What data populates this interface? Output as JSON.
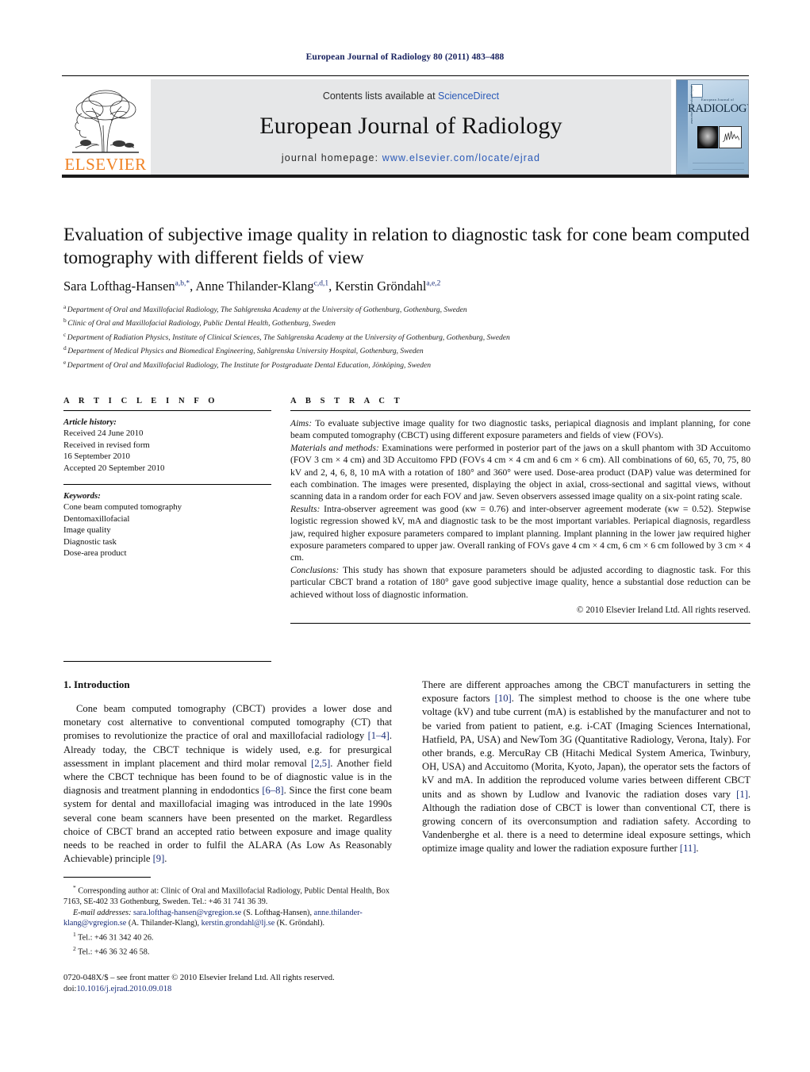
{
  "running_head": "European Journal of Radiology 80 (2011) 483–488",
  "masthead": {
    "contents_prefix": "Contents lists available at ",
    "sciencedirect": "ScienceDirect",
    "journal_name": "European Journal of Radiology",
    "homepage_prefix": "journal homepage: ",
    "homepage_url": "www.elsevier.com/locate/ejrad",
    "publisher": "ELSEVIER",
    "accent_orange": "#f08122",
    "link_blue": "#2b5ab8",
    "band_grey": "#e6e7e8"
  },
  "cover": {
    "small_title": "European Journal of",
    "big_title": "RADIOLOGY",
    "spine_text": "www.elsevier.com/locate/ejrad"
  },
  "article": {
    "title": "Evaluation of subjective image quality in relation to diagnostic task for cone beam computed tomography with different fields of view",
    "authors": [
      {
        "name": "Sara Lofthag-Hansen",
        "sup": "a,b,*"
      },
      {
        "name": "Anne Thilander-Klang",
        "sup": "c,d,1"
      },
      {
        "name": "Kerstin Gröndahl",
        "sup": "a,e,2"
      }
    ],
    "affiliations": [
      {
        "mark": "a",
        "text": "Department of Oral and Maxillofacial Radiology, The Sahlgrenska Academy at the University of Gothenburg, Gothenburg, Sweden"
      },
      {
        "mark": "b",
        "text": "Clinic of Oral and Maxillofacial Radiology, Public Dental Health, Gothenburg, Sweden"
      },
      {
        "mark": "c",
        "text": "Department of Radiation Physics, Institute of Clinical Sciences, The Sahlgrenska Academy at the University of Gothenburg, Gothenburg, Sweden"
      },
      {
        "mark": "d",
        "text": "Department of Medical Physics and Biomedical Engineering, Sahlgrenska University Hospital, Gothenburg, Sweden"
      },
      {
        "mark": "e",
        "text": "Department of Oral and Maxillofacial Radiology, The Institute for Postgraduate Dental Education, Jönköping, Sweden"
      }
    ]
  },
  "article_info": {
    "label": "A R T I C L E    I N F O",
    "history_head": "Article history:",
    "history": [
      "Received 24 June 2010",
      "Received in revised form",
      "16 September 2010",
      "Accepted 20 September 2010"
    ],
    "keywords_head": "Keywords:",
    "keywords": [
      "Cone beam computed tomography",
      "Dentomaxillofacial",
      "Image quality",
      "Diagnostic task",
      "Dose-area product"
    ]
  },
  "abstract": {
    "label": "A B S T R A C T",
    "aims_head": "Aims:",
    "aims_text": " To evaluate subjective image quality for two diagnostic tasks, periapical diagnosis and implant planning, for cone beam computed tomography (CBCT) using different exposure parameters and fields of view (FOVs).",
    "methods_head": "Materials and methods:",
    "methods_text": " Examinations were performed in posterior part of the jaws on a skull phantom with 3D Accuitomo (FOV 3 cm × 4 cm) and 3D Accuitomo FPD (FOVs 4 cm × 4 cm and 6 cm × 6 cm). All combinations of 60, 65, 70, 75, 80 kV and 2, 4, 6, 8, 10 mA with a rotation of 180° and 360° were used. Dose-area product (DAP) value was determined for each combination. The images were presented, displaying the object in axial, cross-sectional and sagittal views, without scanning data in a random order for each FOV and jaw. Seven observers assessed image quality on a six-point rating scale.",
    "results_head": "Results:",
    "results_text": " Intra-observer agreement was good (κw = 0.76) and inter-observer agreement moderate (κw = 0.52). Stepwise logistic regression showed kV, mA and diagnostic task to be the most important variables. Periapical diagnosis, regardless jaw, required higher exposure parameters compared to implant planning. Implant planning in the lower jaw required higher exposure parameters compared to upper jaw. Overall ranking of FOVs gave 4 cm × 4 cm, 6 cm × 6 cm followed by 3 cm × 4 cm.",
    "conclusions_head": "Conclusions:",
    "conclusions_text": " This study has shown that exposure parameters should be adjusted according to diagnostic task. For this particular CBCT brand a rotation of 180° gave good subjective image quality, hence a substantial dose reduction can be achieved without loss of diagnostic information.",
    "copyright": "© 2010 Elsevier Ireland Ltd. All rights reserved."
  },
  "introduction": {
    "heading": "1.  Introduction",
    "para1_a": "Cone beam computed tomography (CBCT) provides a lower dose and monetary cost alternative to conventional computed tomography (CT) that promises to revolutionize the practice of oral and maxillofacial radiology ",
    "ref1": "[1–4]",
    "para1_b": ". Already today, the CBCT technique is widely used, e.g. for presurgical assessment in implant placement and third molar removal ",
    "ref2": "[2,5]",
    "para1_c": ". Another field where the CBCT technique has been found to be of diagnostic value is in the diagnosis and treatment planning in endodontics ",
    "ref3": "[6–8]",
    "para1_d": ". Since the first cone beam system for dental and maxillofacial imaging was introduced in the late 1990s several cone beam scanners have been presented on the market. Regardless choice of CBCT brand an accepted ratio between exposure and image quality needs to be reached in order to fulfil the ALARA (As Low As Reasonably Achievable) principle ",
    "ref4": "[9]",
    "para1_e": ".",
    "para2_a": "There are different approaches among the CBCT manufacturers in setting the exposure factors ",
    "ref5": "[10]",
    "para2_b": ". The simplest method to choose is the one where tube voltage (kV) and tube current (mA) is established by the manufacturer and not to be varied from patient to patient, e.g. i-CAT (Imaging Sciences International, Hatfield, PA, USA) and NewTom 3G (Quantitative Radiology, Verona, Italy). For other brands, e.g. MercuRay CB (Hitachi Medical System America, Twinbury, OH, USA) and Accuitomo (Morita, Kyoto, Japan), the operator sets the factors of kV and mA. In addition the reproduced volume varies between different CBCT units and as shown by Ludlow and Ivanovic the radiation doses vary ",
    "ref6": "[1]",
    "para2_c": ". Although the radiation dose of CBCT is lower than conventional CT, there is growing concern of its overconsumption and radiation safety. According to Vandenberghe et al. there is a need to determine ideal exposure settings, which optimize image quality and lower the radiation exposure further ",
    "ref7": "[11]",
    "para2_d": "."
  },
  "footnotes": {
    "corresponding": "Corresponding author at: Clinic of Oral and Maxillofacial Radiology, Public Dental Health, Box 7163, SE-402 33 Gothenburg, Sweden. Tel.: +46 31 741 36 39.",
    "email_label": "E-mail addresses:",
    "email1": "sara.lofthag-hansen@vgregion.se",
    "email1_owner": " (S. Lofthag-Hansen),",
    "email2": "anne.thilander-klang@vgregion.se",
    "email2_owner": " (A. Thilander-Klang),",
    "email3": "kerstin.grondahl@lj.se",
    "email3_owner": " (K. Gröndahl).",
    "note1_mark": "1",
    "note1": "Tel.: +46 31 342 40 26.",
    "note2_mark": "2",
    "note2": "Tel.: +46 36 32 46 58."
  },
  "imprint": {
    "issn_line": "0720-048X/$ – see front matter © 2010 Elsevier Ireland Ltd. All rights reserved.",
    "doi_label": "doi:",
    "doi": "10.1016/j.ejrad.2010.09.018"
  }
}
